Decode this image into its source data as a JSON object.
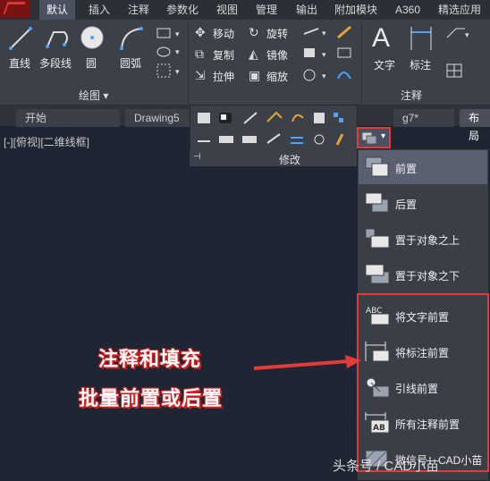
{
  "ribbon_tabs": [
    "默认",
    "插入",
    "注释",
    "参数化",
    "视图",
    "管理",
    "输出",
    "附加模块",
    "A360",
    "精选应用"
  ],
  "draw_group": {
    "tools": [
      "直线",
      "多段线",
      "圆",
      "圆弧"
    ],
    "title": "绘图 ▾"
  },
  "modify_group": {
    "row1": [
      "移动",
      "旋转"
    ],
    "row2": [
      "复制",
      "镜像"
    ],
    "row3": [
      "拉伸",
      "缩放"
    ],
    "title": "修改"
  },
  "annotation_group": {
    "tools": [
      "文字",
      "标注"
    ],
    "title": "注释"
  },
  "file_tabs": [
    "开始",
    "Drawing5",
    "g7*",
    "布局"
  ],
  "viewport_label": "[-][俯视][二维线框]",
  "order_menu": {
    "items": [
      {
        "label": "前置",
        "icon": "bring-to-front-icon"
      },
      {
        "label": "后置",
        "icon": "send-to-back-icon"
      },
      {
        "label": "置于对象之上",
        "icon": "bring-above-objects-icon"
      },
      {
        "label": "置于对象之下",
        "icon": "send-under-objects-icon"
      },
      {
        "label": "将文字前置",
        "icon": "bring-text-to-front-icon",
        "icon_text": "ABC"
      },
      {
        "label": "将标注前置",
        "icon": "bring-dimensions-to-front-icon"
      },
      {
        "label": "引线前置",
        "icon": "bring-leaders-to-front-icon"
      },
      {
        "label": "所有注释前置",
        "icon": "bring-all-annotations-to-front-icon",
        "icon_text": "AB"
      },
      {
        "label": "微信号：CAD小苗",
        "icon": "hatch-to-back-icon"
      }
    ]
  },
  "callout": {
    "line1": "注释和填充",
    "line2": "批量前置或后置"
  },
  "watermark": "头条号 / CAD小苗",
  "colors": {
    "highlight_border": "#e33a3a",
    "callout_shadow": "#d81e1e",
    "background": "#1f2633"
  }
}
